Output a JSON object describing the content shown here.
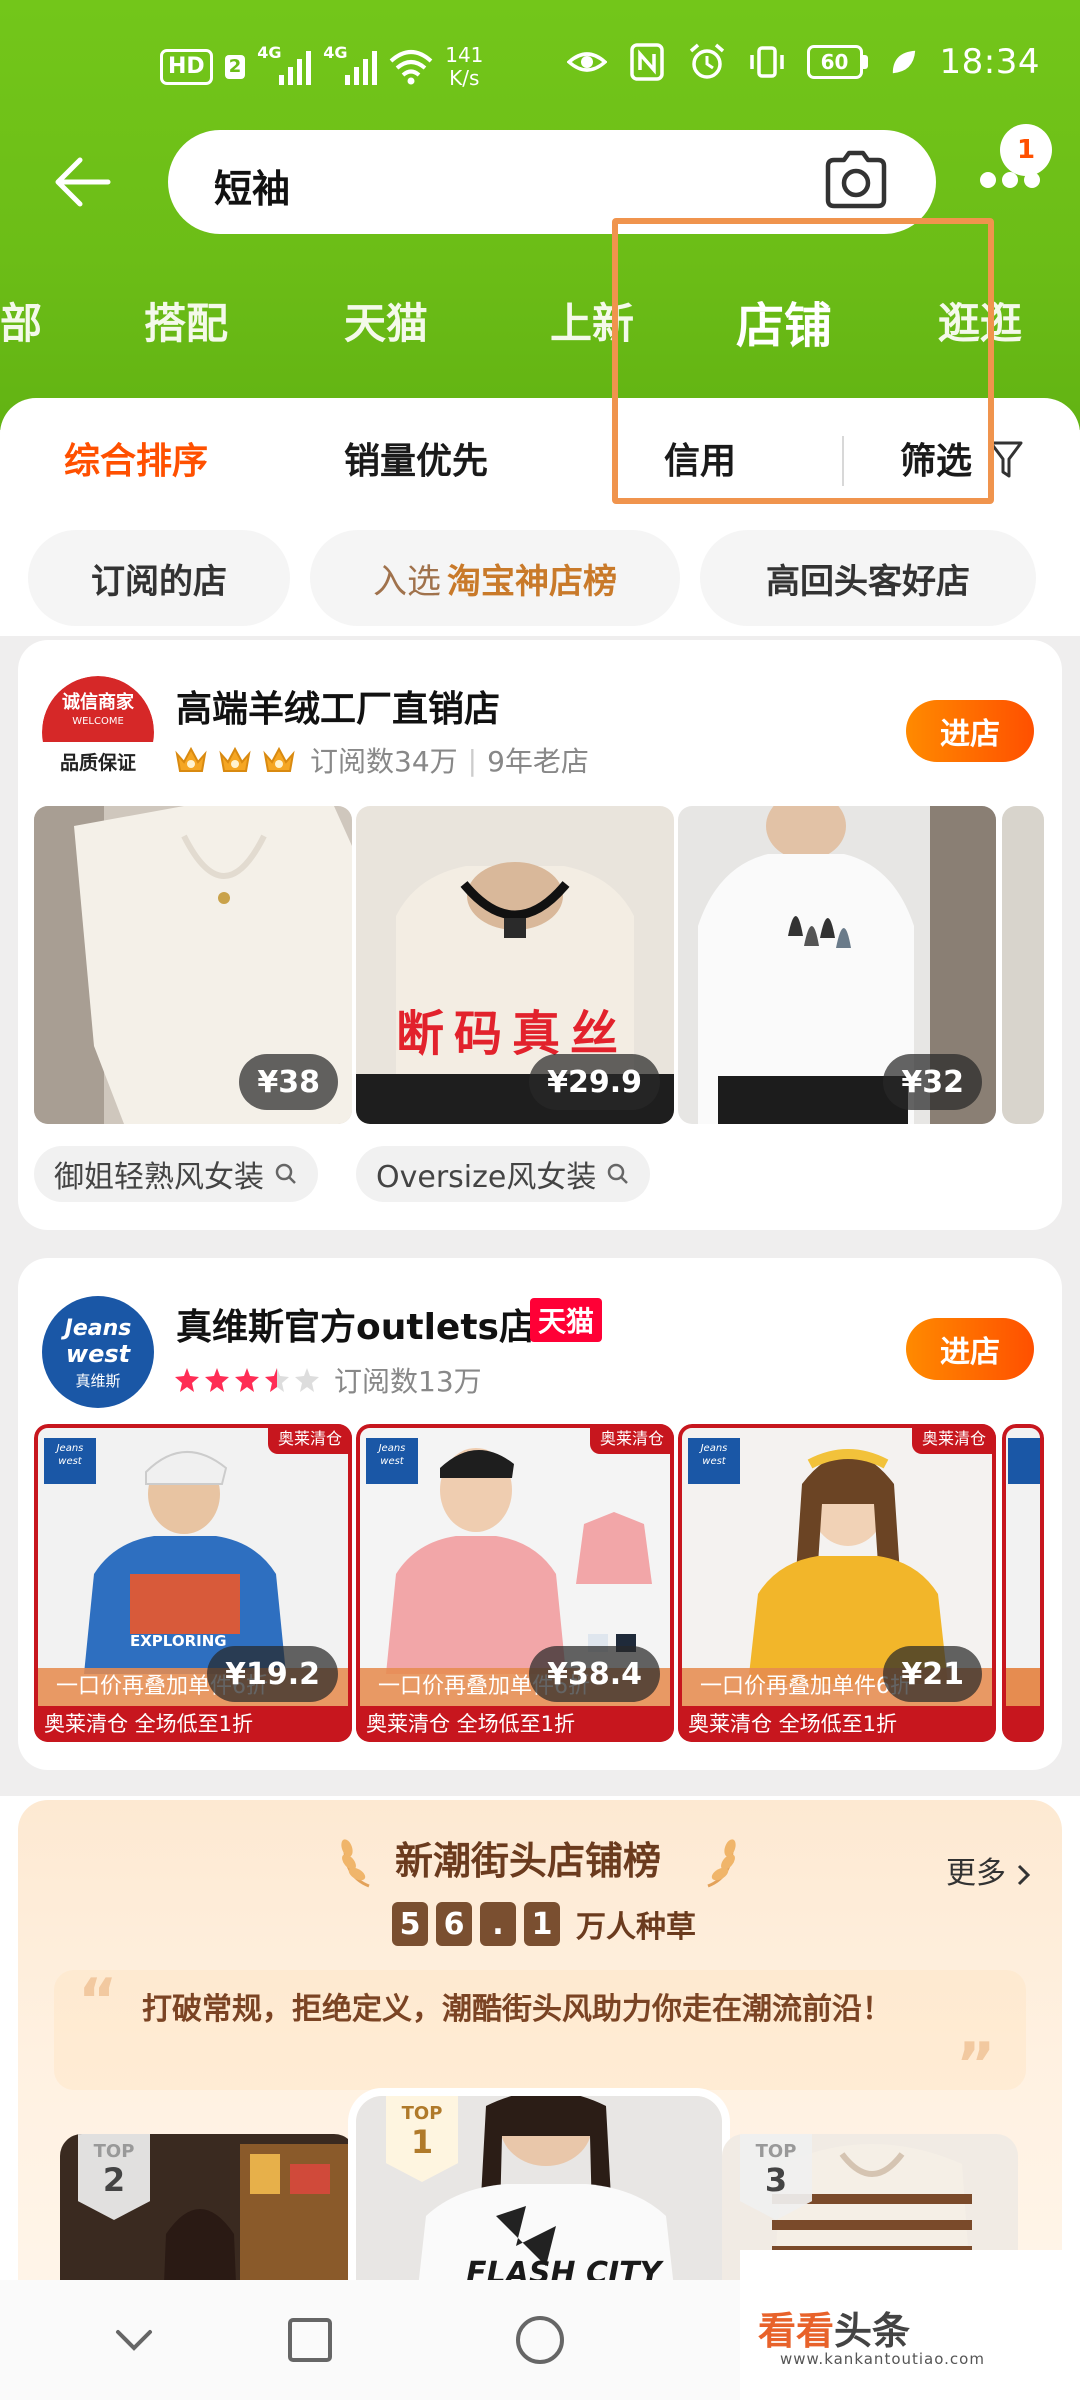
{
  "status_bar": {
    "hd": "HD",
    "sim": "2",
    "net1": "4G",
    "net2": "4G",
    "speed_value": "141",
    "speed_unit": "K/s",
    "battery": "60",
    "time": "18:34"
  },
  "search": {
    "query": "短袖",
    "notification_count": "1"
  },
  "category_tabs": [
    "部",
    "搭配",
    "天猫",
    "上新",
    "店铺",
    "逛逛"
  ],
  "active_category": "店铺",
  "sort_options": {
    "comprehensive": "综合排序",
    "sales": "销量优先",
    "credit": "信用",
    "filter": "筛选"
  },
  "quick_filters": {
    "subscribed": "订阅的店",
    "selected_prefix": "入选",
    "selected_name": "淘宝神店榜",
    "repeat": "高回头客好店"
  },
  "store1": {
    "logo_line1": "诚信商家",
    "logo_line2": "WELCOME",
    "logo_line3": "品质保证",
    "name": "高端羊绒工厂直销店",
    "subscribers": "订阅数34万",
    "age": "9年老店",
    "enter": "进店",
    "products": [
      {
        "price": "¥38"
      },
      {
        "price": "¥29.9",
        "overlay": "断码真丝"
      },
      {
        "price": "¥32"
      }
    ],
    "tags": [
      "御姐轻熟风女装",
      "Oversize风女装"
    ]
  },
  "store2": {
    "logo_line1": "Jeans",
    "logo_line2": "west",
    "logo_line3": "真维斯",
    "name": "真维斯官方outlets店",
    "platform_tag": "天猫",
    "subscribers": "订阅数13万",
    "enter": "进店",
    "rating_stars": 3.5,
    "products": [
      {
        "price": "¥19.2",
        "corner": "奥莱清仓",
        "promo": "一口价再叠加单件6折",
        "clearance": "奥莱清仓 全场低至1折",
        "print": "EXPLORING"
      },
      {
        "price": "¥38.4",
        "corner": "奥莱清仓",
        "promo": "一口价再叠加单件6折",
        "clearance": "奥莱清仓 全场低至1折"
      },
      {
        "price": "¥21",
        "corner": "奥莱清仓",
        "promo": "一口价再叠加单件6折",
        "clearance": "奥莱清仓 全场低至1折"
      }
    ]
  },
  "ranking": {
    "title": "新潮街头店铺榜",
    "more": "更多",
    "count_digits": [
      "5",
      "6",
      ".",
      "1"
    ],
    "count_label": "万人种草",
    "slogan": "打破常规，拒绝定义，潮酷街头风助力你走在潮流前沿！",
    "top_label": "TOP",
    "ranks": [
      "2",
      "1",
      "3"
    ],
    "shirt_print": "FLASH CITY"
  },
  "watermark": {
    "main_a": "看看",
    "main_b": "头条",
    "url": "www.kankantoutiao.com"
  },
  "colors": {
    "header_green": "#6cbd17",
    "accent_orange": "#ff5000",
    "highlight_box": "#f0944d",
    "tmall_red": "#ff0036"
  }
}
